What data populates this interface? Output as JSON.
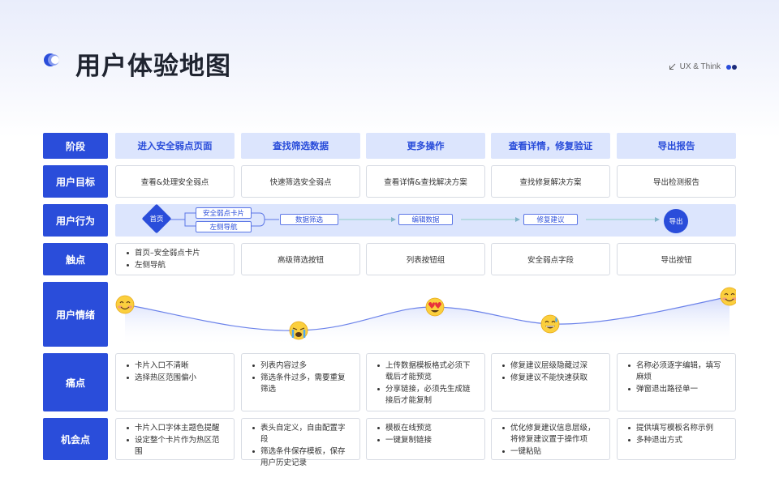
{
  "header": {
    "title": "用户体验地图",
    "brand_text": "UX & Think",
    "brand_icon": "arrow-down-left-icon",
    "brand_dot_colors": [
      "#2a4dda",
      "#1a2a7a"
    ]
  },
  "colors": {
    "primary": "#2a4dda",
    "light": "#dce5fd",
    "curve": "#6b82ea"
  },
  "row_labels": {
    "stage": "阶段",
    "goal": "用户目标",
    "behavior": "用户行为",
    "touchpoint": "触点",
    "emotion": "用户情绪",
    "pain": "痛点",
    "opportunity": "机会点"
  },
  "stages": [
    "进入安全弱点页面",
    "查找筛选数据",
    "更多操作",
    "查看详情，修复验证",
    "导出报告"
  ],
  "goals": [
    "查看&处理安全弱点",
    "快速筛选安全弱点",
    "查看详情&查找解决方案",
    "查找修复解决方案",
    "导出检测报告"
  ],
  "behavior": {
    "start": "首页",
    "branch_top": "安全弱点卡片",
    "branch_bottom": "左侧导航",
    "steps": [
      "数据筛选",
      "编辑数据",
      "修复建议"
    ],
    "end": "导出"
  },
  "touchpoints": {
    "col1": [
      "首页–安全弱点卡片",
      "左侧导航"
    ],
    "col2": "高级筛选按钮",
    "col3": "列表按钮组",
    "col4": "安全弱点字段",
    "col5": "导出按钮"
  },
  "emotions": [
    "smiling-face-icon",
    "crying-face-icon",
    "heart-eyes-face-icon",
    "sweat-smile-face-icon",
    "smiling-face-icon"
  ],
  "pain_points": [
    [
      "卡片入口不清晰",
      "选择热区范围偏小"
    ],
    [
      "列表内容过多",
      "筛选条件过多，需要重复筛选"
    ],
    [
      "上传数据模板格式必须下载后才能预览",
      "分享链接，必须先生成链接后才能复制"
    ],
    [
      "修复建议层级隐藏过深",
      "修复建议不能快速获取"
    ],
    [
      "名称必须逐字编辑，填写麻烦",
      "弹窗退出路径单一"
    ]
  ],
  "opportunities": [
    [
      "卡片入口字体主题色提醒",
      "设定整个卡片作为热区范围"
    ],
    [
      "表头自定义，自由配置字段",
      "筛选条件保存模板，保存用户历史记录"
    ],
    [
      "模板在线预览",
      "一键复制链接"
    ],
    [
      "优化修复建议信息层级，将修复建议置于操作项",
      "一键粘贴"
    ],
    [
      "提供填写模板名称示例",
      "多种退出方式"
    ]
  ]
}
